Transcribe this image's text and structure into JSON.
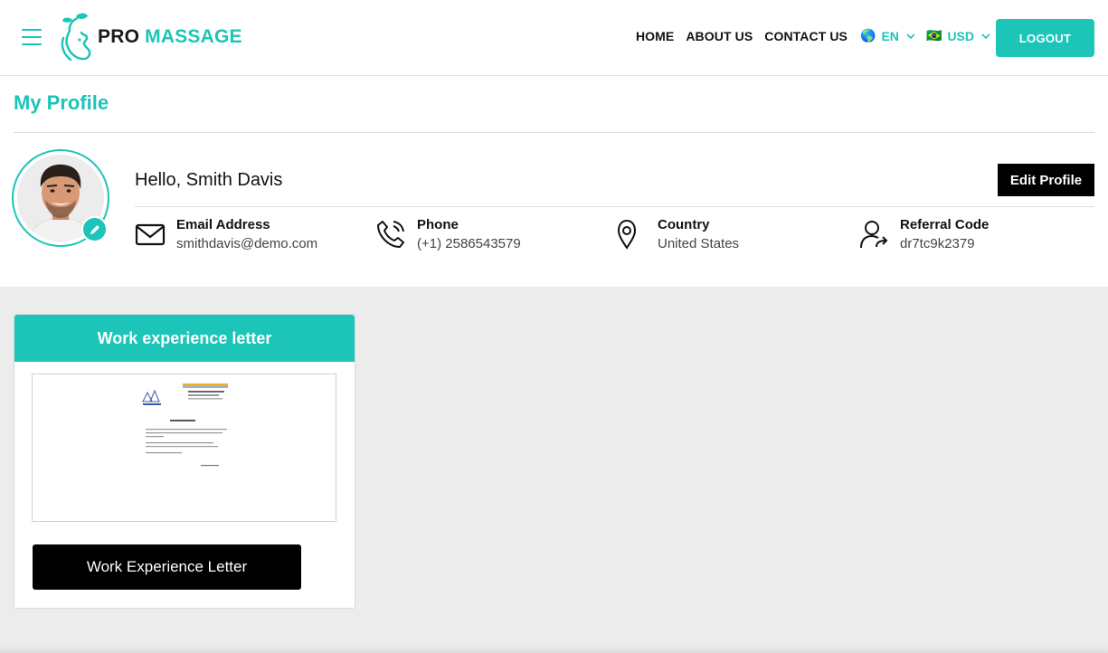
{
  "header": {
    "logo_pro": "PRO",
    "logo_massage": "MASSAGE",
    "nav": [
      {
        "label": "HOME"
      },
      {
        "label": "ABOUT US"
      },
      {
        "label": "CONTACT US"
      }
    ],
    "language": {
      "flag": "🌎",
      "label": "EN"
    },
    "currency": {
      "flag": "🇧🇷",
      "label": "USD"
    },
    "logout_label": "LOGOUT"
  },
  "profile": {
    "page_title": "My Profile",
    "greeting": "Hello, Smith Davis",
    "edit_label": "Edit Profile",
    "fields": [
      {
        "label": "Email Address",
        "value": "smithdavis@demo.com",
        "icon": "envelope-icon"
      },
      {
        "label": "Phone",
        "value": "(+1) 2586543579",
        "icon": "phone-icon"
      },
      {
        "label": "Country",
        "value": "United States",
        "icon": "location-pin-icon"
      },
      {
        "label": "Referral Code",
        "value": "dr7tc9k2379",
        "icon": "user-share-icon"
      }
    ]
  },
  "document_card": {
    "title": "Work experience letter",
    "button_label": "Work Experience Letter"
  },
  "colors": {
    "accent": "#1cc5b7",
    "dark": "#000000",
    "background": "#ececec"
  }
}
